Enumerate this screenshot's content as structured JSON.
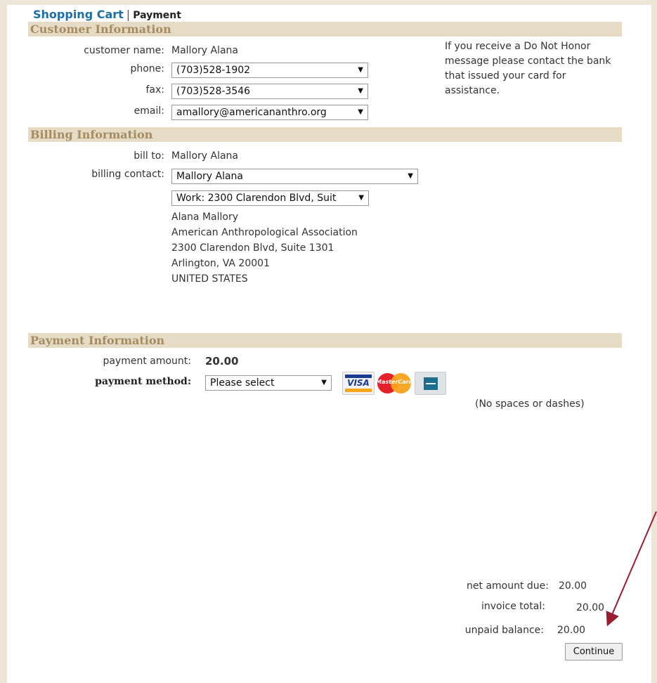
{
  "breadcrumb": {
    "link": "Shopping Cart",
    "separator": "|",
    "current": "Payment"
  },
  "customer": {
    "heading": "Customer Information",
    "name_label": "customer name:",
    "name_value": "Mallory Alana",
    "phone_label": "phone:",
    "phone_value": "(703)528-1902",
    "fax_label": "fax:",
    "fax_value": "(703)528-3546",
    "email_label": "email:",
    "email_value": "amallory@americananthro.org",
    "note": "If you receive a Do Not Honor message please contact the bank that issued your card for assistance."
  },
  "billing": {
    "heading": "Billing Information",
    "bill_to_label": "bill to:",
    "bill_to_value": "Mallory Alana",
    "contact_label": "billing contact:",
    "contact_value": "Mallory Alana",
    "address_select": "Work: 2300 Clarendon Blvd, Suit",
    "address_lines": [
      "Alana Mallory",
      "American Anthropological Association",
      "2300 Clarendon Blvd, Suite 1301",
      "Arlington, VA 20001",
      "UNITED STATES"
    ]
  },
  "payment": {
    "heading": "Payment Information",
    "amount_label": "payment amount:",
    "amount_value": "20.00",
    "method_label": "payment method:",
    "method_value": "Please select",
    "cards": {
      "visa": "VISA",
      "mastercard": "MasterCard",
      "amex": ""
    },
    "hint": "(No spaces or dashes)"
  },
  "totals": {
    "net_label": "net amount due:",
    "net_value": "20.00",
    "invoice_label": "invoice total:",
    "invoice_value": "20.00",
    "unpaid_label": "unpaid balance:",
    "unpaid_value": "20.00"
  },
  "actions": {
    "continue_label": "Continue"
  },
  "icons": {
    "select_arrow": "▼"
  },
  "colors": {
    "section_bar": "#e6dcc5",
    "section_text": "#a58b62",
    "link": "#1d6fa5",
    "annotation_arrow": "#9b1b30"
  }
}
